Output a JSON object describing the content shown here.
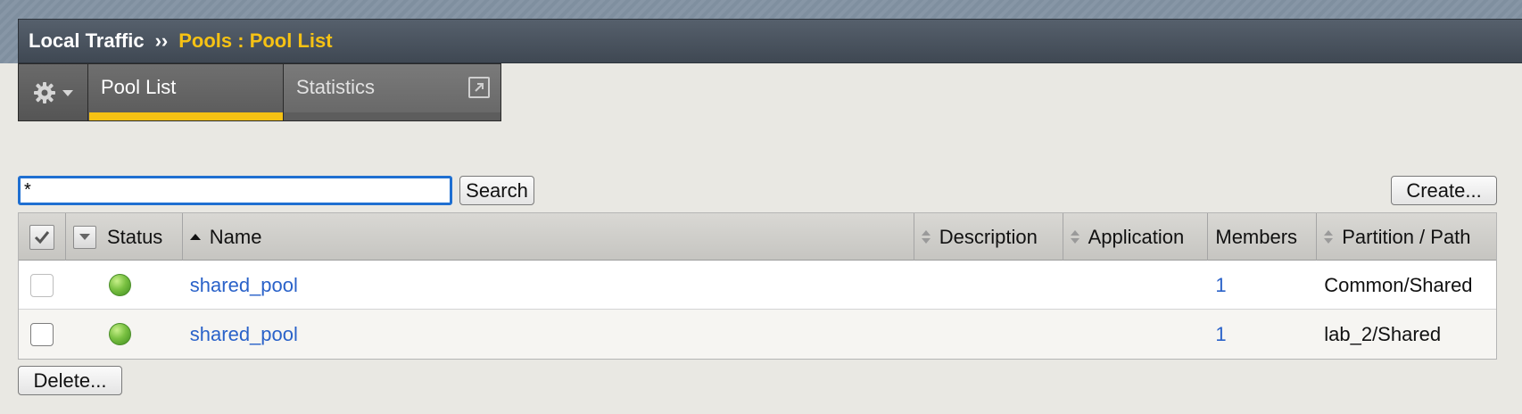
{
  "breadcrumb": {
    "root": "Local Traffic",
    "separator": "››",
    "current": "Pools : Pool List"
  },
  "tabs": [
    {
      "label": "Pool List",
      "active": true
    },
    {
      "label": "Statistics",
      "active": false,
      "icon": "popout-icon"
    }
  ],
  "colors": {
    "accent": "#f6c214",
    "link": "#2a62c9",
    "status_available": "#7ac142",
    "focus": "#1f6fd1"
  },
  "search": {
    "value": "*",
    "button_label": "Search"
  },
  "create_label": "Create...",
  "delete_label": "Delete...",
  "table": {
    "headers": {
      "status": "Status",
      "name": "Name",
      "description": "Description",
      "application": "Application",
      "members": "Members",
      "partition": "Partition / Path"
    },
    "sort": {
      "column": "Name",
      "direction": "ascending"
    },
    "rows": [
      {
        "checkbox_enabled": false,
        "status": "available",
        "name": "shared_pool",
        "description": "",
        "application": "",
        "members": "1",
        "partition": "Common/Shared"
      },
      {
        "checkbox_enabled": true,
        "status": "available",
        "name": "shared_pool",
        "description": "",
        "application": "",
        "members": "1",
        "partition": "lab_2/Shared"
      }
    ]
  }
}
